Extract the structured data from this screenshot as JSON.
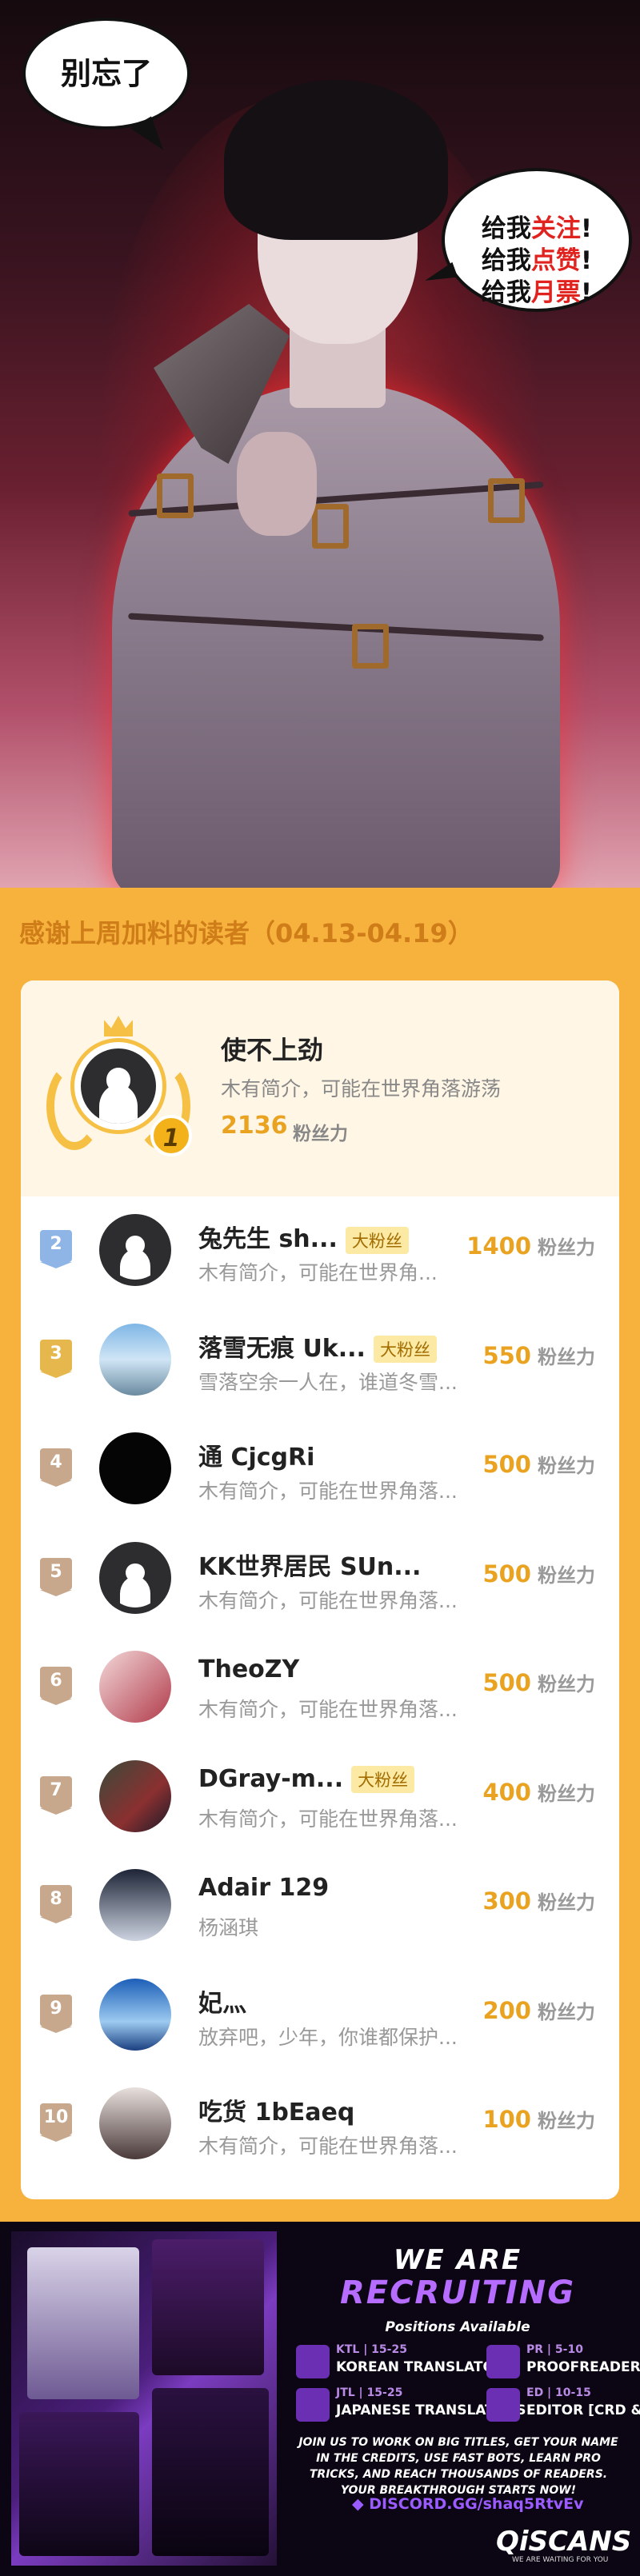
{
  "banner": {
    "bubble_left": "别忘了",
    "bubble_right_lines": [
      {
        "prefix": "给我",
        "highlight": "关注",
        "suffix": "!"
      },
      {
        "prefix": "给我",
        "highlight": "点赞",
        "suffix": "!"
      },
      {
        "prefix": "给我",
        "highlight": "月票",
        "suffix": "!"
      }
    ]
  },
  "section_title": "感谢上周加料的读者（04.13-04.19）",
  "top_reader": {
    "rank": "1",
    "name": "使不上劲",
    "intro": "木有简介，可能在世界角落游荡",
    "fans": "2136",
    "fans_label": "粉丝力"
  },
  "readers": [
    {
      "rank": "2",
      "name": "兔先生  sh...",
      "badge": "大粉丝",
      "intro": "木有简介，可能在世界角...",
      "fans": "1400",
      "unit": "粉丝力"
    },
    {
      "rank": "3",
      "name": "落雪无痕  Uk...",
      "badge": "大粉丝",
      "intro": "雪落空余一人在，谁道冬雪...",
      "fans": "550",
      "unit": "粉丝力"
    },
    {
      "rank": "4",
      "name": "通    CjcgRi",
      "badge": "",
      "intro": "木有简介，可能在世界角落...",
      "fans": "500",
      "unit": "粉丝力"
    },
    {
      "rank": "5",
      "name": "KK世界居民  SUn...",
      "badge": "",
      "intro": "木有简介，可能在世界角落...",
      "fans": "500",
      "unit": "粉丝力"
    },
    {
      "rank": "6",
      "name": "TheoZY",
      "badge": "",
      "intro": "木有简介，可能在世界角落...",
      "fans": "500",
      "unit": "粉丝力"
    },
    {
      "rank": "7",
      "name": "DGray-m...",
      "badge": "大粉丝",
      "intro": "木有简介，可能在世界角落...",
      "fans": "400",
      "unit": "粉丝力"
    },
    {
      "rank": "8",
      "name": "Adair  129",
      "badge": "",
      "intro": "杨涵琪",
      "fans": "300",
      "unit": "粉丝力"
    },
    {
      "rank": "9",
      "name": "妃灬",
      "badge": "",
      "intro": "放弃吧，少年，你谁都保护...",
      "fans": "200",
      "unit": "粉丝力"
    },
    {
      "rank": "10",
      "name": "吃货    1bEaeq",
      "badge": "",
      "intro": "木有简介，可能在世界角落...",
      "fans": "100",
      "unit": "粉丝力"
    }
  ],
  "ad": {
    "headline1": "WE ARE",
    "headline2": "RECRUITING",
    "subtitle": "Positions Available",
    "roles": [
      {
        "code": "KTL | 15-25",
        "title": "KOREAN TRANSLATORS"
      },
      {
        "code": "PR | 5-10",
        "title": "PROOFREADERS"
      },
      {
        "code": "JTL | 15-25",
        "title": "JAPANESE TRANSLATORS"
      },
      {
        "code": "ED | 10-15",
        "title": "EDITOR [CRD & TS]"
      }
    ],
    "description": "JOIN US TO WORK ON BIG TITLES, GET YOUR NAME IN THE CREDITS, USE FAST BOTS, LEARN PRO TRICKS, AND REACH THOUSANDS OF READERS. YOUR BREAKTHROUGH STARTS NOW!",
    "discord": "DISCORD.GG/shaq5RtvEv",
    "logo": "QiSCANS",
    "logo_sub": "WE ARE WAITING FOR YOU"
  },
  "colors": {
    "accent_orange": "#e9a321",
    "title_orange": "#cf7d18",
    "badge_bg": "#fbe9a4",
    "rank2": "#8fb4e6",
    "rank3": "#e6b74c",
    "rank_rest": "#c8a88c",
    "ad_purple": "#b56cff"
  }
}
